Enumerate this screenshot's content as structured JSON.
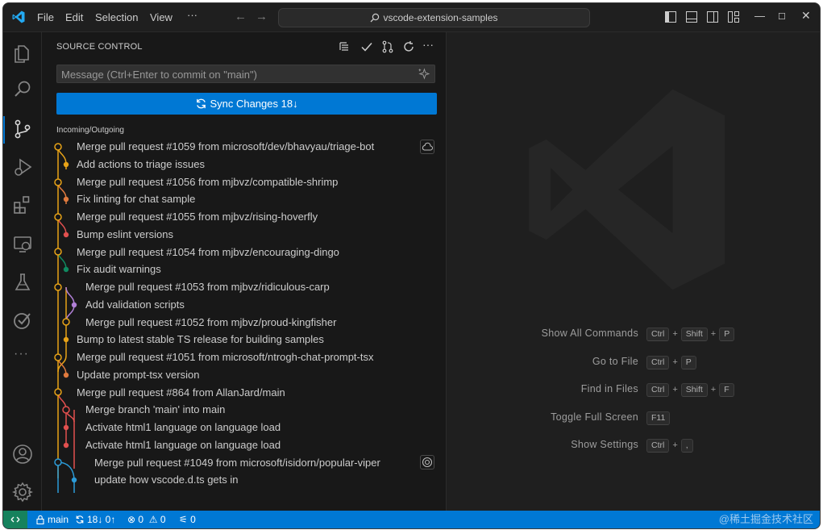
{
  "window": {
    "menu": [
      "File",
      "Edit",
      "Selection",
      "View",
      "···"
    ],
    "search_text": "vscode-extension-samples"
  },
  "scm": {
    "title": "SOURCE CONTROL",
    "message_placeholder": "Message (Ctrl+Enter to commit on \"main\")",
    "sync_label": "Sync Changes 18",
    "section": "Incoming/Outgoing",
    "commits": [
      "Merge pull request #1059 from microsoft/dev/bhavyau/triage-bot",
      "Add actions to triage issues",
      "Merge pull request #1056 from mjbvz/compatible-shrimp",
      "Fix linting for chat sample",
      "Merge pull request #1055 from mjbvz/rising-hoverfly",
      "Bump eslint versions",
      "Merge pull request #1054 from mjbvz/encouraging-dingo",
      "Fix audit warnings",
      "Merge pull request #1053 from mjbvz/ridiculous-carp",
      "Add validation scripts",
      "Merge pull request #1052 from mjbvz/proud-kingfisher",
      "Bump to latest stable TS release for building samples",
      "Merge pull request #1051 from microsoft/ntrogh-chat-prompt-tsx",
      "Update prompt-tsx version",
      "Merge pull request #864 from AllanJard/main",
      "Merge branch 'main' into main",
      "Activate html1 language on language load",
      "Activate html1 language on language load",
      "Merge pull request #1049 from microsoft/isidorn/popular-viper",
      "update how vscode.d.ts gets in"
    ]
  },
  "shortcuts": [
    {
      "label": "Show All Commands",
      "keys": [
        "Ctrl",
        "Shift",
        "P"
      ]
    },
    {
      "label": "Go to File",
      "keys": [
        "Ctrl",
        "P"
      ]
    },
    {
      "label": "Find in Files",
      "keys": [
        "Ctrl",
        "Shift",
        "F"
      ]
    },
    {
      "label": "Toggle Full Screen",
      "keys": [
        "F11"
      ]
    },
    {
      "label": "Show Settings",
      "keys": [
        "Ctrl",
        ","
      ]
    }
  ],
  "status": {
    "branch": "main",
    "sync": "18↓ 0↑",
    "errors": "0",
    "warnings": "0",
    "ports": "0",
    "watermark": "@稀土掘金技术社区"
  },
  "colors": {
    "accent": "#0078d4",
    "remote": "#16825d",
    "graph_lanes": [
      "#e8a317",
      "#b180d7",
      "#e2504f",
      "#e07a3e",
      "#0f8a60",
      "#2b9bd8"
    ]
  }
}
